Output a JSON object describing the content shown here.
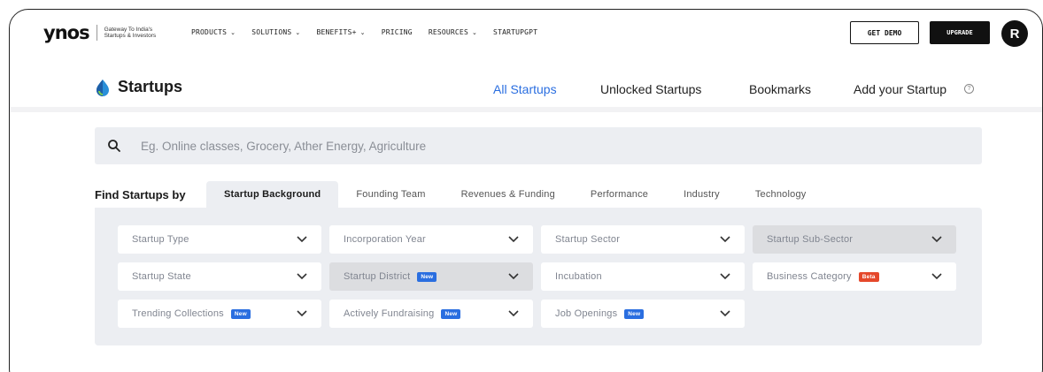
{
  "brand": {
    "logo": "ynos",
    "tagline": "Gateway To India's Startups & Investors"
  },
  "topnav": {
    "menu": [
      {
        "label": "PRODUCTS",
        "dropdown": true
      },
      {
        "label": "SOLUTIONS",
        "dropdown": true
      },
      {
        "label": "BENEFITS+",
        "dropdown": true
      },
      {
        "label": "PRICING",
        "dropdown": false
      },
      {
        "label": "RESOURCES",
        "dropdown": true
      },
      {
        "label": "STARTUPGPT",
        "dropdown": false
      }
    ],
    "get_demo": "GET DEMO",
    "upgrade": "UPGRADE",
    "avatar_initial": "R"
  },
  "subheader": {
    "title": "Startups",
    "nav": [
      "All Startups",
      "Unlocked Startups",
      "Bookmarks",
      "Add your Startup"
    ],
    "active_nav": "All Startups",
    "help_icon": "?"
  },
  "search": {
    "placeholder": "Eg. Online classes, Grocery, Ather Energy, Agriculture"
  },
  "filters": {
    "label": "Find Startups by",
    "tabs": [
      "Startup Background",
      "Founding Team",
      "Revenues & Funding",
      "Performance",
      "Industry",
      "Technology"
    ],
    "active_tab": "Startup Background",
    "dropdowns": [
      {
        "label": "Startup Type",
        "badge": "",
        "disabled": false
      },
      {
        "label": "Incorporation Year",
        "badge": "",
        "disabled": false
      },
      {
        "label": "Startup Sector",
        "badge": "",
        "disabled": false
      },
      {
        "label": "Startup Sub-Sector",
        "badge": "",
        "disabled": true
      },
      {
        "label": "Startup State",
        "badge": "",
        "disabled": false
      },
      {
        "label": "Startup District",
        "badge": "New",
        "disabled": true
      },
      {
        "label": "Incubation",
        "badge": "",
        "disabled": false
      },
      {
        "label": "Business Category",
        "badge": "Beta",
        "disabled": false
      },
      {
        "label": "Trending Collections",
        "badge": "New",
        "disabled": false
      },
      {
        "label": "Actively Fundraising",
        "badge": "New",
        "disabled": false
      },
      {
        "label": "Job Openings",
        "badge": "New",
        "disabled": false
      }
    ]
  },
  "colors": {
    "accent": "#2a6ee0",
    "panel": "#eceef2",
    "badge_new": "#2a6ee0",
    "badge_beta": "#e5482b"
  }
}
